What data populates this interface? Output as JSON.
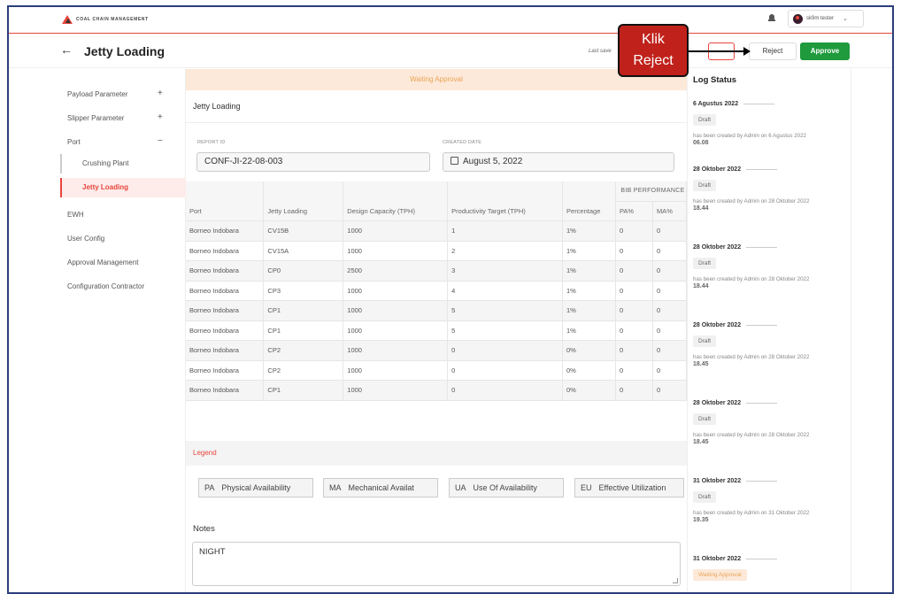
{
  "app": {
    "logo_text": "COAL CHAIN MANAGEMENT",
    "user_name": "sk9m tester"
  },
  "header": {
    "title": "Jetty Loading",
    "last_saved": "Last save",
    "reject_label": "Reject",
    "approve_label": "Approve"
  },
  "callout": {
    "line1": "Klik",
    "line2": "Reject"
  },
  "sidebar": {
    "items": [
      {
        "label": "Payload Parameter",
        "toggle": "+"
      },
      {
        "label": "Slipper Parameter",
        "toggle": "+"
      },
      {
        "label": "Port",
        "toggle": "−"
      },
      {
        "label": "Crushing Plant"
      },
      {
        "label": "Jetty Loading"
      },
      {
        "label": "EWH"
      },
      {
        "label": "User Config"
      },
      {
        "label": "Approval Management"
      },
      {
        "label": "Configuration Contractor"
      }
    ]
  },
  "main": {
    "status_banner": "Waiting Approval",
    "section_title": "Jetty Loading",
    "report_id_label": "REPORT ID",
    "report_id_value": "CONF-JI-22-08-003",
    "created_date_label": "CREATED DATE",
    "created_date_value": "August 5, 2022"
  },
  "table": {
    "group_header": "BIB PERFORMANCE",
    "columns": [
      "Port",
      "Jetty Loading",
      "Design Capacity (TPH)",
      "Productivity Target (TPH)",
      "Percentage",
      "PA%",
      "MA%"
    ],
    "rows": [
      [
        "Borneo Indobara",
        "CV15B",
        "1000",
        "1",
        "1%",
        "0",
        "0"
      ],
      [
        "Borneo Indobara",
        "CV15A",
        "1000",
        "2",
        "1%",
        "0",
        "0"
      ],
      [
        "Borneo Indobara",
        "CP0",
        "2500",
        "3",
        "1%",
        "0",
        "0"
      ],
      [
        "Borneo Indobara",
        "CP3",
        "1000",
        "4",
        "1%",
        "0",
        "0"
      ],
      [
        "Borneo Indobara",
        "CP1",
        "1000",
        "5",
        "1%",
        "0",
        "0"
      ],
      [
        "Borneo Indobara",
        "CP1",
        "1000",
        "5",
        "1%",
        "0",
        "0"
      ],
      [
        "Borneo Indobara",
        "CP2",
        "1000",
        "0",
        "0%",
        "0",
        "0"
      ],
      [
        "Borneo Indobara",
        "CP2",
        "1000",
        "0",
        "0%",
        "0",
        "0"
      ],
      [
        "Borneo Indobara",
        "CP1",
        "1000",
        "0",
        "0%",
        "0",
        "0"
      ]
    ]
  },
  "legend": {
    "title": "Legend",
    "items": [
      {
        "abbr": "PA",
        "label": "Physical Availability"
      },
      {
        "abbr": "MA",
        "label": "Mechanical Availat"
      },
      {
        "abbr": "UA",
        "label": "Use Of Availability"
      },
      {
        "abbr": "EU",
        "label": "Effective Utilization"
      }
    ]
  },
  "notes": {
    "label": "Notes",
    "value": "NIGHT"
  },
  "log": {
    "title": "Log Status",
    "entries": [
      {
        "date": "6 Agustus 2022",
        "badge": "Draft",
        "message": "has been created by Admin on 6 Agustus 2022",
        "time": "06.08"
      },
      {
        "date": "28 Oktober 2022",
        "badge": "Draft",
        "message": "has been created by Admin on 28 Oktober 2022",
        "time": "18.44"
      },
      {
        "date": "28 Oktober 2022",
        "badge": "Draft",
        "message": "has been created by Admin on 28 Oktober 2022",
        "time": "18.44"
      },
      {
        "date": "28 Oktober 2022",
        "badge": "Draft",
        "message": "has been created by Admin on 28 Oktober 2022",
        "time": "18.45"
      },
      {
        "date": "28 Oktober 2022",
        "badge": "Draft",
        "message": "has been created by Admin on 28 Oktober 2022",
        "time": "18.45"
      },
      {
        "date": "31 Oktober 2022",
        "badge": "Draft",
        "message": "has been created by Admin on 31 Oktober 2022",
        "time": "19.35"
      },
      {
        "date": "31 Oktober 2022",
        "badge": "Waiting Approval"
      }
    ]
  },
  "colors": {
    "brand_red": "#e8453c",
    "approve_green": "#1f9a3c",
    "waiting_orange": "#e8a456",
    "callout_red": "#c0221b"
  }
}
